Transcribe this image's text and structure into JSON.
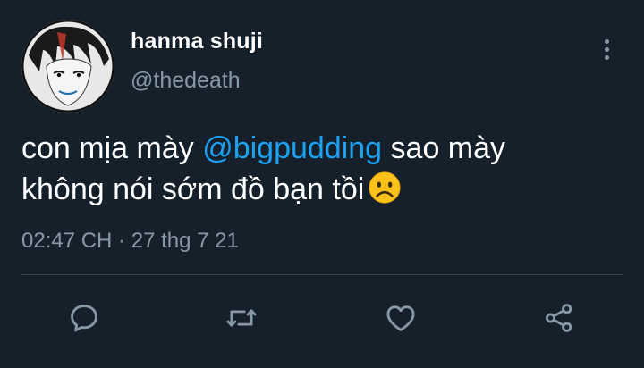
{
  "author": {
    "display_name": "hanma shuji",
    "handle": "@thedeath"
  },
  "tweet": {
    "text_line1_before": "con mịa mày ",
    "mention": "@bigpudding",
    "text_line1_after": " sao mày",
    "text_line2": "không nói sớm đồ bạn tồi",
    "emoji": "frowning-face",
    "timestamp": "02:47 CH · 27 thg 7 21"
  },
  "actions": {
    "reply_icon": "reply-icon",
    "retweet_icon": "retweet-icon",
    "like_icon": "heart-icon",
    "share_icon": "share-icon"
  },
  "colors": {
    "background": "#15202b",
    "text": "#ffffff",
    "secondary_text": "#8899a6",
    "mention": "#1da1f2",
    "divider": "#38444d"
  }
}
